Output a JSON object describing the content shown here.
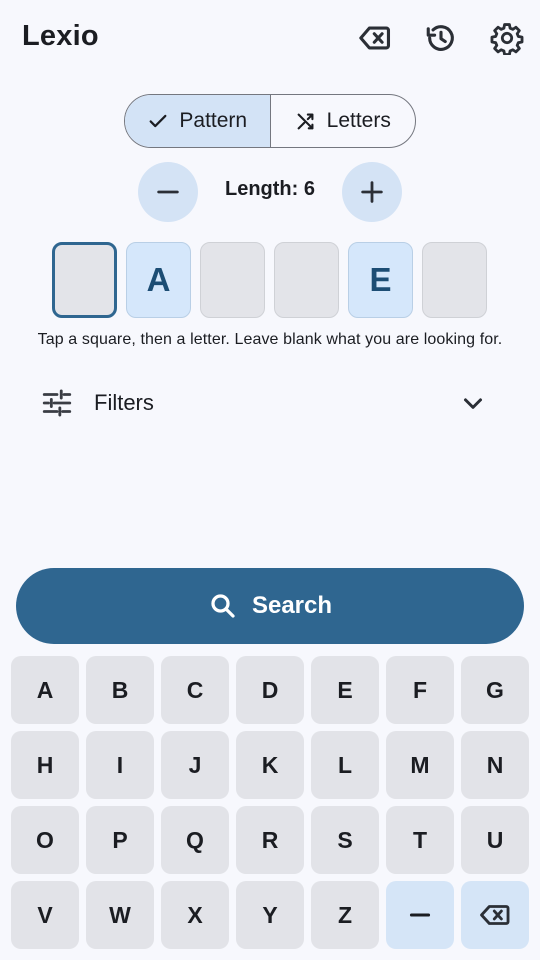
{
  "app": {
    "title": "Lexio"
  },
  "header": {
    "icons": [
      "backspace-icon",
      "history-icon",
      "settings-gear-icon"
    ]
  },
  "mode_toggle": {
    "selected": "pattern",
    "pattern_label": "Pattern",
    "letters_label": "Letters"
  },
  "length": {
    "label": "Length: 6",
    "value": 6
  },
  "tiles": [
    "",
    "A",
    "",
    "",
    "E",
    ""
  ],
  "hint": "Tap a square, then a letter. Leave blank what you are looking for.",
  "filters": {
    "label": "Filters",
    "expanded": false
  },
  "search": {
    "label": "Search"
  },
  "keyboard": {
    "rows": [
      [
        "A",
        "B",
        "C",
        "D",
        "E",
        "F",
        "G"
      ],
      [
        "H",
        "I",
        "J",
        "K",
        "L",
        "M",
        "N"
      ],
      [
        "O",
        "P",
        "Q",
        "R",
        "S",
        "T",
        "U"
      ],
      [
        "V",
        "W",
        "X",
        "Y",
        "Z"
      ]
    ],
    "blank_key": "–"
  },
  "colors": {
    "primary": "#2f6690",
    "selected_container": "#d3e3f6",
    "tile_filled": "#d5e7fb",
    "key_bg": "#e2e3e8",
    "background": "#f7f8fd"
  }
}
